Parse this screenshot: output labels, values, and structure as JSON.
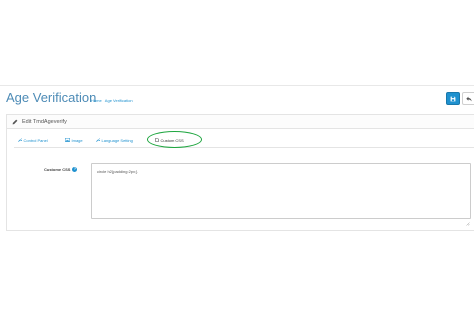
{
  "header": {
    "title": "Age Verification",
    "breadcrumb": [
      {
        "label": "Home"
      },
      {
        "label": "Age Verification"
      }
    ],
    "save_icon": "save-icon",
    "back_icon": "reply-icon"
  },
  "panel": {
    "heading": "Edit TmdAgeverify",
    "heading_icon": "pencil-icon"
  },
  "tabs": [
    {
      "label": "Control Panel",
      "icon": "wrench-icon",
      "active": false
    },
    {
      "label": "Image",
      "icon": "image-icon",
      "active": false
    },
    {
      "label": "Language Setting",
      "icon": "wrench-icon",
      "active": false
    },
    {
      "label": "Custom CSS",
      "icon": "file-icon",
      "active": true
    }
  ],
  "form": {
    "css_label": "Custome CSS",
    "css_value": "circle h2{padding:2px;}"
  },
  "colors": {
    "accent": "#1e91cf",
    "title": "#4d8bb6",
    "highlight_ring": "#1fa640"
  }
}
